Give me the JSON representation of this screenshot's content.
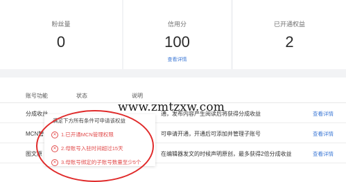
{
  "stats": [
    {
      "label": "粉丝量",
      "value": "0"
    },
    {
      "label": "信用分",
      "value": "100",
      "link": "查看详情"
    },
    {
      "label": "已开通权益",
      "value": "2"
    }
  ],
  "table": {
    "headers": [
      "账号功能",
      "状态",
      "说明"
    ],
    "rows": [
      {
        "name": "分成收益",
        "desc": "通，发布内容产生阅读后将获得分成收益",
        "action": "查看详情"
      },
      {
        "name": "MCN管",
        "desc": "可申请开通，开通后可添加并管理子账号",
        "action": "查看详情"
      },
      {
        "name": "图文原",
        "desc": "在编辑器发文的时候声明原创，最多获得2倍分成收益",
        "action": "查看详情"
      }
    ]
  },
  "popover": {
    "title": "满足下方所有条件可申请该权益",
    "conditions": [
      "1.已开通MCN管理权限",
      "2.母账号入驻时间超过15天",
      "3.母账号绑定的子账号数量至少5个"
    ]
  },
  "watermark": "www.zmtzxw.com",
  "colors": {
    "link": "#3e79d6",
    "error": "#e14b4b",
    "highlight_circle": "#e02a2a"
  }
}
